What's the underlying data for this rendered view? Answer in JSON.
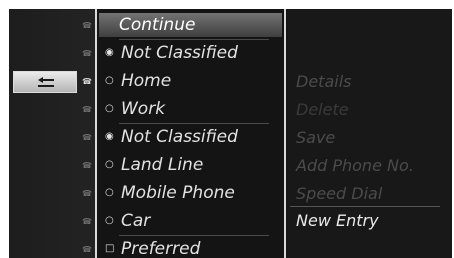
{
  "menu": {
    "items": [
      {
        "label": "Continue",
        "mark": ""
      },
      {
        "label": "Not Classified",
        "mark": "◉"
      },
      {
        "label": "Home",
        "mark": "○"
      },
      {
        "label": "Work",
        "mark": "○"
      },
      {
        "label": "Not Classified",
        "mark": "◉"
      },
      {
        "label": "Land Line",
        "mark": "○"
      },
      {
        "label": "Mobile Phone",
        "mark": "○"
      },
      {
        "label": "Car",
        "mark": "○"
      },
      {
        "label": "Preferred",
        "mark": "□"
      }
    ]
  },
  "right_menu": {
    "items": [
      {
        "label": "Details"
      },
      {
        "label": "Delete"
      },
      {
        "label": "Save"
      },
      {
        "label": "Add Phone No."
      },
      {
        "label": "Speed Dial"
      },
      {
        "label": "New Entry"
      }
    ]
  },
  "icons": {
    "back": "back-arrow-icon",
    "phone": "phone-icon"
  }
}
